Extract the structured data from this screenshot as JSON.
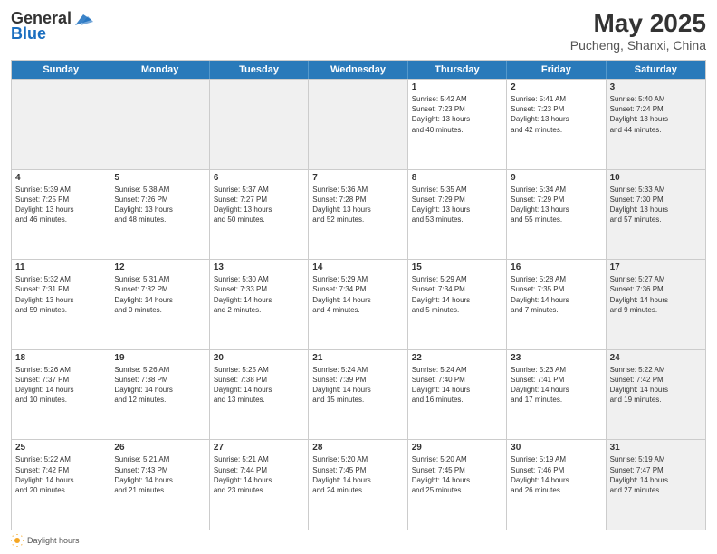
{
  "header": {
    "logo_general": "General",
    "logo_blue": "Blue",
    "month_title": "May 2025",
    "location": "Pucheng, Shanxi, China"
  },
  "calendar": {
    "days_of_week": [
      "Sunday",
      "Monday",
      "Tuesday",
      "Wednesday",
      "Thursday",
      "Friday",
      "Saturday"
    ],
    "rows": [
      [
        {
          "day": "",
          "info": "",
          "shaded": true
        },
        {
          "day": "",
          "info": "",
          "shaded": true
        },
        {
          "day": "",
          "info": "",
          "shaded": true
        },
        {
          "day": "",
          "info": "",
          "shaded": true
        },
        {
          "day": "1",
          "info": "Sunrise: 5:42 AM\nSunset: 7:23 PM\nDaylight: 13 hours\nand 40 minutes.",
          "shaded": false
        },
        {
          "day": "2",
          "info": "Sunrise: 5:41 AM\nSunset: 7:23 PM\nDaylight: 13 hours\nand 42 minutes.",
          "shaded": false
        },
        {
          "day": "3",
          "info": "Sunrise: 5:40 AM\nSunset: 7:24 PM\nDaylight: 13 hours\nand 44 minutes.",
          "shaded": true
        }
      ],
      [
        {
          "day": "4",
          "info": "Sunrise: 5:39 AM\nSunset: 7:25 PM\nDaylight: 13 hours\nand 46 minutes.",
          "shaded": false
        },
        {
          "day": "5",
          "info": "Sunrise: 5:38 AM\nSunset: 7:26 PM\nDaylight: 13 hours\nand 48 minutes.",
          "shaded": false
        },
        {
          "day": "6",
          "info": "Sunrise: 5:37 AM\nSunset: 7:27 PM\nDaylight: 13 hours\nand 50 minutes.",
          "shaded": false
        },
        {
          "day": "7",
          "info": "Sunrise: 5:36 AM\nSunset: 7:28 PM\nDaylight: 13 hours\nand 52 minutes.",
          "shaded": false
        },
        {
          "day": "8",
          "info": "Sunrise: 5:35 AM\nSunset: 7:29 PM\nDaylight: 13 hours\nand 53 minutes.",
          "shaded": false
        },
        {
          "day": "9",
          "info": "Sunrise: 5:34 AM\nSunset: 7:29 PM\nDaylight: 13 hours\nand 55 minutes.",
          "shaded": false
        },
        {
          "day": "10",
          "info": "Sunrise: 5:33 AM\nSunset: 7:30 PM\nDaylight: 13 hours\nand 57 minutes.",
          "shaded": true
        }
      ],
      [
        {
          "day": "11",
          "info": "Sunrise: 5:32 AM\nSunset: 7:31 PM\nDaylight: 13 hours\nand 59 minutes.",
          "shaded": false
        },
        {
          "day": "12",
          "info": "Sunrise: 5:31 AM\nSunset: 7:32 PM\nDaylight: 14 hours\nand 0 minutes.",
          "shaded": false
        },
        {
          "day": "13",
          "info": "Sunrise: 5:30 AM\nSunset: 7:33 PM\nDaylight: 14 hours\nand 2 minutes.",
          "shaded": false
        },
        {
          "day": "14",
          "info": "Sunrise: 5:29 AM\nSunset: 7:34 PM\nDaylight: 14 hours\nand 4 minutes.",
          "shaded": false
        },
        {
          "day": "15",
          "info": "Sunrise: 5:29 AM\nSunset: 7:34 PM\nDaylight: 14 hours\nand 5 minutes.",
          "shaded": false
        },
        {
          "day": "16",
          "info": "Sunrise: 5:28 AM\nSunset: 7:35 PM\nDaylight: 14 hours\nand 7 minutes.",
          "shaded": false
        },
        {
          "day": "17",
          "info": "Sunrise: 5:27 AM\nSunset: 7:36 PM\nDaylight: 14 hours\nand 9 minutes.",
          "shaded": true
        }
      ],
      [
        {
          "day": "18",
          "info": "Sunrise: 5:26 AM\nSunset: 7:37 PM\nDaylight: 14 hours\nand 10 minutes.",
          "shaded": false
        },
        {
          "day": "19",
          "info": "Sunrise: 5:26 AM\nSunset: 7:38 PM\nDaylight: 14 hours\nand 12 minutes.",
          "shaded": false
        },
        {
          "day": "20",
          "info": "Sunrise: 5:25 AM\nSunset: 7:38 PM\nDaylight: 14 hours\nand 13 minutes.",
          "shaded": false
        },
        {
          "day": "21",
          "info": "Sunrise: 5:24 AM\nSunset: 7:39 PM\nDaylight: 14 hours\nand 15 minutes.",
          "shaded": false
        },
        {
          "day": "22",
          "info": "Sunrise: 5:24 AM\nSunset: 7:40 PM\nDaylight: 14 hours\nand 16 minutes.",
          "shaded": false
        },
        {
          "day": "23",
          "info": "Sunrise: 5:23 AM\nSunset: 7:41 PM\nDaylight: 14 hours\nand 17 minutes.",
          "shaded": false
        },
        {
          "day": "24",
          "info": "Sunrise: 5:22 AM\nSunset: 7:42 PM\nDaylight: 14 hours\nand 19 minutes.",
          "shaded": true
        }
      ],
      [
        {
          "day": "25",
          "info": "Sunrise: 5:22 AM\nSunset: 7:42 PM\nDaylight: 14 hours\nand 20 minutes.",
          "shaded": false
        },
        {
          "day": "26",
          "info": "Sunrise: 5:21 AM\nSunset: 7:43 PM\nDaylight: 14 hours\nand 21 minutes.",
          "shaded": false
        },
        {
          "day": "27",
          "info": "Sunrise: 5:21 AM\nSunset: 7:44 PM\nDaylight: 14 hours\nand 23 minutes.",
          "shaded": false
        },
        {
          "day": "28",
          "info": "Sunrise: 5:20 AM\nSunset: 7:45 PM\nDaylight: 14 hours\nand 24 minutes.",
          "shaded": false
        },
        {
          "day": "29",
          "info": "Sunrise: 5:20 AM\nSunset: 7:45 PM\nDaylight: 14 hours\nand 25 minutes.",
          "shaded": false
        },
        {
          "day": "30",
          "info": "Sunrise: 5:19 AM\nSunset: 7:46 PM\nDaylight: 14 hours\nand 26 minutes.",
          "shaded": false
        },
        {
          "day": "31",
          "info": "Sunrise: 5:19 AM\nSunset: 7:47 PM\nDaylight: 14 hours\nand 27 minutes.",
          "shaded": true
        }
      ]
    ]
  },
  "footer": {
    "note": "Daylight hours"
  }
}
